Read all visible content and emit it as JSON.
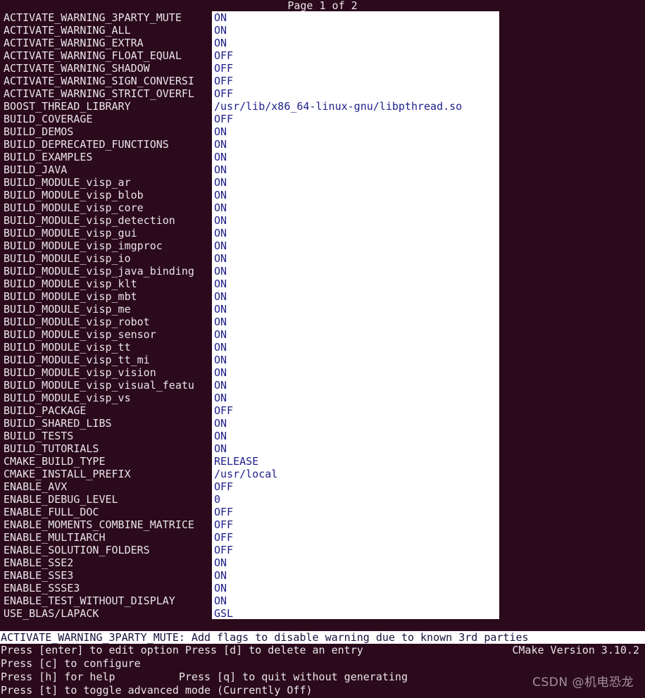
{
  "terminal": {
    "background_color": "#2b0a1c",
    "foreground_color": "#e8e4e6",
    "panel_color": "#ffffff",
    "value_text_color": "#1d1f8a",
    "status_text_color": "#18103a"
  },
  "header": {
    "page_indicator": "Page 1 of 2"
  },
  "cache_entries": [
    {
      "name": "ACTIVATE_WARNING_3PARTY_MUTE",
      "value": "ON"
    },
    {
      "name": "ACTIVATE_WARNING_ALL",
      "value": "ON"
    },
    {
      "name": "ACTIVATE_WARNING_EXTRA",
      "value": "ON"
    },
    {
      "name": "ACTIVATE_WARNING_FLOAT_EQUAL",
      "value": "OFF"
    },
    {
      "name": "ACTIVATE_WARNING_SHADOW",
      "value": "OFF"
    },
    {
      "name": "ACTIVATE_WARNING_SIGN_CONVERSI",
      "value": "OFF"
    },
    {
      "name": "ACTIVATE_WARNING_STRICT_OVERFL",
      "value": "OFF"
    },
    {
      "name": "BOOST_THREAD_LIBRARY",
      "value": "/usr/lib/x86_64-linux-gnu/libpthread.so"
    },
    {
      "name": "BUILD_COVERAGE",
      "value": "OFF"
    },
    {
      "name": "BUILD_DEMOS",
      "value": "ON"
    },
    {
      "name": "BUILD_DEPRECATED_FUNCTIONS",
      "value": "ON"
    },
    {
      "name": "BUILD_EXAMPLES",
      "value": "ON"
    },
    {
      "name": "BUILD_JAVA",
      "value": "ON"
    },
    {
      "name": "BUILD_MODULE_visp_ar",
      "value": "ON"
    },
    {
      "name": "BUILD_MODULE_visp_blob",
      "value": "ON"
    },
    {
      "name": "BUILD_MODULE_visp_core",
      "value": "ON"
    },
    {
      "name": "BUILD_MODULE_visp_detection",
      "value": "ON"
    },
    {
      "name": "BUILD_MODULE_visp_gui",
      "value": "ON"
    },
    {
      "name": "BUILD_MODULE_visp_imgproc",
      "value": "ON"
    },
    {
      "name": "BUILD_MODULE_visp_io",
      "value": "ON"
    },
    {
      "name": "BUILD_MODULE_visp_java_binding",
      "value": "ON"
    },
    {
      "name": "BUILD_MODULE_visp_klt",
      "value": "ON"
    },
    {
      "name": "BUILD_MODULE_visp_mbt",
      "value": "ON"
    },
    {
      "name": "BUILD_MODULE_visp_me",
      "value": "ON"
    },
    {
      "name": "BUILD_MODULE_visp_robot",
      "value": "ON"
    },
    {
      "name": "BUILD_MODULE_visp_sensor",
      "value": "ON"
    },
    {
      "name": "BUILD_MODULE_visp_tt",
      "value": "ON"
    },
    {
      "name": "BUILD_MODULE_visp_tt_mi",
      "value": "ON"
    },
    {
      "name": "BUILD_MODULE_visp_vision",
      "value": "ON"
    },
    {
      "name": "BUILD_MODULE_visp_visual_featu",
      "value": "ON"
    },
    {
      "name": "BUILD_MODULE_visp_vs",
      "value": "ON"
    },
    {
      "name": "BUILD_PACKAGE",
      "value": "OFF"
    },
    {
      "name": "BUILD_SHARED_LIBS",
      "value": "ON"
    },
    {
      "name": "BUILD_TESTS",
      "value": "ON"
    },
    {
      "name": "BUILD_TUTORIALS",
      "value": "ON"
    },
    {
      "name": "CMAKE_BUILD_TYPE",
      "value": "RELEASE"
    },
    {
      "name": "CMAKE_INSTALL_PREFIX",
      "value": "/usr/local"
    },
    {
      "name": "ENABLE_AVX",
      "value": "OFF"
    },
    {
      "name": "ENABLE_DEBUG_LEVEL",
      "value": "0"
    },
    {
      "name": "ENABLE_FULL_DOC",
      "value": "OFF"
    },
    {
      "name": "ENABLE_MOMENTS_COMBINE_MATRICE",
      "value": "OFF"
    },
    {
      "name": "ENABLE_MULTIARCH",
      "value": "OFF"
    },
    {
      "name": "ENABLE_SOLUTION_FOLDERS",
      "value": "OFF"
    },
    {
      "name": "ENABLE_SSE2",
      "value": "ON"
    },
    {
      "name": "ENABLE_SSE3",
      "value": "ON"
    },
    {
      "name": "ENABLE_SSSE3",
      "value": "ON"
    },
    {
      "name": "ENABLE_TEST_WITHOUT_DISPLAY",
      "value": "ON"
    },
    {
      "name": "USE_BLAS/LAPACK",
      "value": "GSL"
    }
  ],
  "status_bar": {
    "text": "ACTIVATE_WARNING_3PARTY_MUTE: Add flags to disable warning due to known 3rd parties"
  },
  "help": {
    "lines": [
      "Press [enter] to edit option Press [d] to delete an entry",
      "Press [c] to configure",
      "Press [h] for help          Press [q] to quit without generating",
      "Press [t] to toggle advanced mode (Currently Off)"
    ],
    "version_label": "CMake Version 3.10.2"
  },
  "watermark": {
    "text": "CSDN @机电恐龙"
  }
}
